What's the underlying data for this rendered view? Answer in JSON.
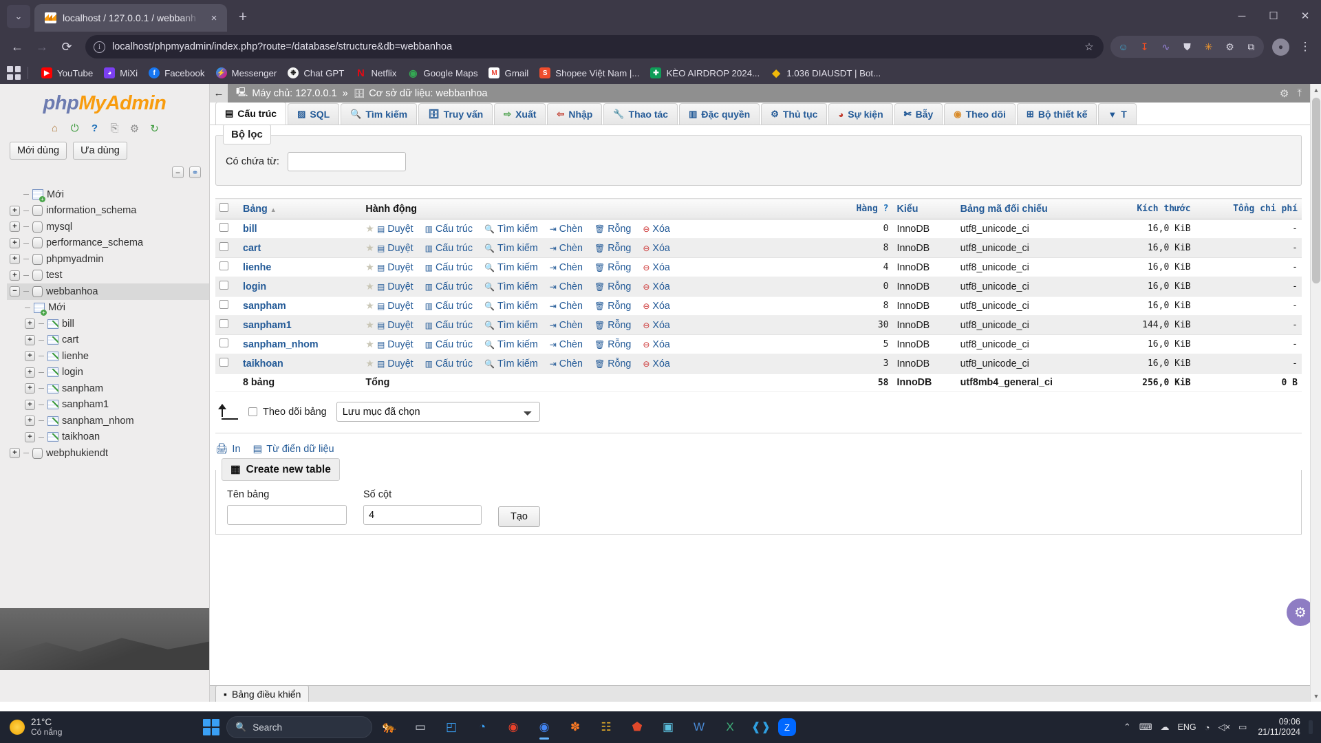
{
  "browser": {
    "tab": {
      "title": "localhost / 127.0.0.1 / webbanh",
      "favicon": "phpmyadmin-icon",
      "close": "×"
    },
    "new_tab_label": "+",
    "tab_list_label": "⌄",
    "window_controls": {
      "minimize": "─",
      "maximize": "☐",
      "close": "✕"
    },
    "nav": {
      "back": "←",
      "forward": "→",
      "reload": "⟳"
    },
    "omnibox": {
      "info_icon": "i",
      "url": "localhost/phpmyadmin/index.php?route=/database/structure&db=webbanhoa",
      "bookmark_star": "☆"
    },
    "extensions": [
      {
        "name": "smiley-extension-icon",
        "glyph": "☺",
        "color": "#3fa9d0"
      },
      {
        "name": "idm-extension-icon",
        "glyph": "↧",
        "color": "#f04e23"
      },
      {
        "name": "wave-extension-icon",
        "glyph": "∿",
        "color": "#7a60c8"
      },
      {
        "name": "shield-extension-icon",
        "glyph": "⛊",
        "color": "#cdd0d8"
      },
      {
        "name": "star-extension-icon",
        "glyph": "✳",
        "color": "#f0972e"
      },
      {
        "name": "gear-extension-icon",
        "glyph": "⚙",
        "color": "#cdd0d8"
      },
      {
        "name": "puzzle-extension-icon",
        "glyph": "⧉",
        "color": "#cdd0d8"
      }
    ],
    "profile_initial": "●",
    "menu_glyph": "⋮",
    "bookmarks": [
      {
        "label": "YouTube",
        "icon": "youtube-icon",
        "glyph": "▶",
        "color": "#ff0000"
      },
      {
        "label": "MiXi",
        "icon": "mixi-icon",
        "glyph": "◕",
        "color": "#7b3ff2"
      },
      {
        "label": "Facebook",
        "icon": "facebook-icon",
        "glyph": "f",
        "color": "#1877f2"
      },
      {
        "label": "Messenger",
        "icon": "messenger-icon",
        "glyph": "⚡",
        "color": "#a033ff"
      },
      {
        "label": "Chat GPT",
        "icon": "chatgpt-icon",
        "glyph": "✿",
        "color": "#f4f4f4"
      },
      {
        "label": "Netflix",
        "icon": "netflix-icon",
        "glyph": "N",
        "color": "#e50914"
      },
      {
        "label": "Google Maps",
        "icon": "googlemaps-icon",
        "glyph": "◉",
        "color": "#34a853"
      },
      {
        "label": "Gmail",
        "icon": "gmail-icon",
        "glyph": "M",
        "color": "#ea4335"
      },
      {
        "label": "Shopee Việt Nam |...",
        "icon": "shopee-icon",
        "glyph": "S",
        "color": "#ee4d2d"
      },
      {
        "label": "KÈO AIRDROP 2024...",
        "icon": "sheets-icon",
        "glyph": "✚",
        "color": "#0f9d58"
      },
      {
        "label": "1.036 DIAUSDT | Bot...",
        "icon": "binance-icon",
        "glyph": "◆",
        "color": "#f0b90b"
      }
    ],
    "apps_button": "apps-grid-icon"
  },
  "pma": {
    "logo": {
      "part1": "php",
      "part2": "MyAdmin"
    },
    "header_icons": [
      {
        "name": "home-icon",
        "glyph": "⌂"
      },
      {
        "name": "logout-icon",
        "glyph": "⏻"
      },
      {
        "name": "help-icon",
        "glyph": "?"
      },
      {
        "name": "docs-icon",
        "glyph": "⎘"
      },
      {
        "name": "settings-icon",
        "glyph": "⚙"
      },
      {
        "name": "reload-icon",
        "glyph": "↻"
      }
    ],
    "quick_buttons": [
      {
        "label": "Mới dùng",
        "name": "recent-button"
      },
      {
        "label": "Ưa dùng",
        "name": "favourites-button"
      }
    ],
    "collapse_icons": [
      {
        "name": "collapse-all-icon",
        "glyph": "−"
      },
      {
        "name": "unlink-icon",
        "glyph": "⚭"
      }
    ],
    "tree": [
      {
        "label": "Mới",
        "type": "new",
        "expander": "none",
        "indent": 0,
        "selected": false
      },
      {
        "label": "information_schema",
        "type": "db",
        "expander": "+",
        "indent": 0,
        "selected": false
      },
      {
        "label": "mysql",
        "type": "db",
        "expander": "+",
        "indent": 0,
        "selected": false
      },
      {
        "label": "performance_schema",
        "type": "db",
        "expander": "+",
        "indent": 0,
        "selected": false
      },
      {
        "label": "phpmyadmin",
        "type": "db",
        "expander": "+",
        "indent": 0,
        "selected": false
      },
      {
        "label": "test",
        "type": "db",
        "expander": "+",
        "indent": 0,
        "selected": false
      },
      {
        "label": "webbanhoa",
        "type": "db",
        "expander": "−",
        "indent": 0,
        "selected": true
      },
      {
        "label": "Mới",
        "type": "new",
        "expander": "none",
        "indent": 1,
        "selected": false
      },
      {
        "label": "bill",
        "type": "table",
        "expander": "+",
        "indent": 1,
        "selected": false
      },
      {
        "label": "cart",
        "type": "table",
        "expander": "+",
        "indent": 1,
        "selected": false
      },
      {
        "label": "lienhe",
        "type": "table",
        "expander": "+",
        "indent": 1,
        "selected": false
      },
      {
        "label": "login",
        "type": "table",
        "expander": "+",
        "indent": 1,
        "selected": false
      },
      {
        "label": "sanpham",
        "type": "table",
        "expander": "+",
        "indent": 1,
        "selected": false
      },
      {
        "label": "sanpham1",
        "type": "table",
        "expander": "+",
        "indent": 1,
        "selected": false
      },
      {
        "label": "sanpham_nhom",
        "type": "table",
        "expander": "+",
        "indent": 1,
        "selected": false
      },
      {
        "label": "taikhoan",
        "type": "table",
        "expander": "+",
        "indent": 1,
        "selected": false
      },
      {
        "label": "webphukiendt",
        "type": "db",
        "expander": "+",
        "indent": 0,
        "selected": false
      }
    ],
    "breadcrumb": {
      "back_glyph": "←",
      "server_icon": "server-icon",
      "server_label": "Máy chủ: 127.0.0.1",
      "separator": "»",
      "db_icon": "database-icon",
      "db_label": "Cơ sở dữ liệu: webbanhoa",
      "settings_glyph": "⚙",
      "collapse_glyph": "⤒"
    },
    "tabs": [
      {
        "label": "Cấu trúc",
        "icon": "structure-icon",
        "glyph": "▤",
        "active": true
      },
      {
        "label": "SQL",
        "icon": "sql-icon",
        "glyph": "⌸",
        "active": false
      },
      {
        "label": "Tìm kiếm",
        "icon": "search-icon",
        "glyph": "⌕",
        "active": false
      },
      {
        "label": "Truy vấn",
        "icon": "query-icon",
        "glyph": "⛃",
        "active": false
      },
      {
        "label": "Xuất",
        "icon": "export-icon",
        "glyph": "⇨",
        "active": false
      },
      {
        "label": "Nhập",
        "icon": "import-icon",
        "glyph": "⇦",
        "active": false
      },
      {
        "label": "Thao tác",
        "icon": "operations-icon",
        "glyph": "⚒",
        "active": false
      },
      {
        "label": "Đặc quyền",
        "icon": "privileges-icon",
        "glyph": "▥",
        "active": false
      },
      {
        "label": "Thủ tục",
        "icon": "routines-icon",
        "glyph": "⚙",
        "active": false
      },
      {
        "label": "Sự kiện",
        "icon": "events-icon",
        "glyph": "◴",
        "active": false
      },
      {
        "label": "Bẫy",
        "icon": "triggers-icon",
        "glyph": "✂",
        "active": false
      },
      {
        "label": "Theo dõi",
        "icon": "tracking-icon",
        "glyph": "◉",
        "active": false
      },
      {
        "label": "Bộ thiết kế",
        "icon": "designer-icon",
        "glyph": "⊞",
        "active": false
      },
      {
        "label": "T",
        "icon": "more-tabs-icon",
        "glyph": "▼",
        "active": false
      }
    ],
    "filter": {
      "legend": "Bộ lọc",
      "label": "Có chứa từ:",
      "value": "",
      "placeholder": ""
    },
    "table": {
      "columns": [
        {
          "label": "Bảng",
          "sort": "▲",
          "name": "col-table"
        },
        {
          "label": "Hành động",
          "name": "col-action"
        },
        {
          "label": "Hàng",
          "help": "?",
          "name": "col-rows"
        },
        {
          "label": "Kiểu",
          "name": "col-type"
        },
        {
          "label": "Bảng mã đối chiếu",
          "name": "col-collation"
        },
        {
          "label": "Kích thước",
          "name": "col-size"
        },
        {
          "label": "Tổng chi phí",
          "name": "col-overhead"
        }
      ],
      "actions": [
        {
          "label": "Duyệt",
          "icon": "browse-icon",
          "glyph": "▤"
        },
        {
          "label": "Cấu trúc",
          "icon": "structure-icon",
          "glyph": "▥"
        },
        {
          "label": "Tìm kiếm",
          "icon": "search-icon",
          "glyph": "⌕"
        },
        {
          "label": "Chèn",
          "icon": "insert-icon",
          "glyph": "⤓"
        },
        {
          "label": "Rỗng",
          "icon": "empty-icon",
          "glyph": "⌸"
        },
        {
          "label": "Xóa",
          "icon": "drop-icon",
          "glyph": "⊖"
        }
      ],
      "rows": [
        {
          "name": "bill",
          "rows": "0",
          "type": "InnoDB",
          "collation": "utf8_unicode_ci",
          "size": "16,0 KiB",
          "overhead": "-"
        },
        {
          "name": "cart",
          "rows": "8",
          "type": "InnoDB",
          "collation": "utf8_unicode_ci",
          "size": "16,0 KiB",
          "overhead": "-"
        },
        {
          "name": "lienhe",
          "rows": "4",
          "type": "InnoDB",
          "collation": "utf8_unicode_ci",
          "size": "16,0 KiB",
          "overhead": "-"
        },
        {
          "name": "login",
          "rows": "0",
          "type": "InnoDB",
          "collation": "utf8_unicode_ci",
          "size": "16,0 KiB",
          "overhead": "-"
        },
        {
          "name": "sanpham",
          "rows": "8",
          "type": "InnoDB",
          "collation": "utf8_unicode_ci",
          "size": "16,0 KiB",
          "overhead": "-"
        },
        {
          "name": "sanpham1",
          "rows": "30",
          "type": "InnoDB",
          "collation": "utf8_unicode_ci",
          "size": "144,0 KiB",
          "overhead": "-"
        },
        {
          "name": "sanpham_nhom",
          "rows": "5",
          "type": "InnoDB",
          "collation": "utf8_unicode_ci",
          "size": "16,0 KiB",
          "overhead": "-"
        },
        {
          "name": "taikhoan",
          "rows": "3",
          "type": "InnoDB",
          "collation": "utf8_unicode_ci",
          "size": "16,0 KiB",
          "overhead": "-"
        }
      ],
      "summary": {
        "count_label": "8 bảng",
        "total_label": "Tổng",
        "rows": "58",
        "type": "InnoDB",
        "collation": "utf8mb4_general_ci",
        "size": "256,0 KiB",
        "overhead": "0 B"
      }
    },
    "below_table": {
      "check_all_icon": "select-all-arrow-icon",
      "track_label": "Theo dõi bảng",
      "with_selected": "Lưu mục đã chọn"
    },
    "print_row": [
      {
        "label": "In",
        "icon": "print-icon",
        "glyph": "⎙"
      },
      {
        "label": "Từ điển dữ liệu",
        "icon": "data-dictionary-icon",
        "glyph": "▤"
      }
    ],
    "create_table": {
      "legend": "Create new table",
      "legend_icon": "new-table-icon",
      "name_label": "Tên bảng",
      "name_value": "",
      "cols_label": "Số cột",
      "cols_value": "4",
      "submit_label": "Tạo"
    },
    "console": {
      "label": "Bảng điều khiển",
      "icon": "console-icon",
      "glyph": "■"
    },
    "float_gear": {
      "name": "settings-fab-icon",
      "glyph": "⚙",
      "color": "#8e7cc3"
    },
    "scrollbar": {
      "up": "▲",
      "down": "▼"
    }
  },
  "taskbar": {
    "weather": {
      "temp": "21°C",
      "desc": "Có nắng",
      "icon": "sun-icon"
    },
    "start": {
      "name": "start-button",
      "label": "Start"
    },
    "search": {
      "placeholder": "Search",
      "icon": "search-icon"
    },
    "apps": [
      {
        "name": "taskview-icon",
        "glyph": "▭",
        "color": "#cfd3da",
        "active": false
      },
      {
        "name": "widgets-icon",
        "glyph": "◰",
        "color": "#3aa0f5",
        "active": false
      },
      {
        "name": "edge-icon",
        "glyph": "◔",
        "color": "#3aa0f5",
        "active": false
      },
      {
        "name": "opera-gx-icon",
        "glyph": "◉",
        "color": "#e8412a",
        "active": false
      },
      {
        "name": "chrome-icon",
        "glyph": "◉",
        "color": "#4285f4",
        "active": true
      },
      {
        "name": "xampp-icon",
        "glyph": "✽",
        "color": "#fb7a24",
        "active": false
      },
      {
        "name": "file-explorer-icon",
        "glyph": "☷",
        "color": "#f0b429",
        "active": false
      },
      {
        "name": "brave-icon",
        "glyph": "⬟",
        "color": "#e0492b",
        "active": false
      },
      {
        "name": "store-icon",
        "glyph": "▣",
        "color": "#5bc0de",
        "active": false
      },
      {
        "name": "word-icon",
        "glyph": "W",
        "color": "#2b579a",
        "active": false
      },
      {
        "name": "excel-icon",
        "glyph": "X",
        "color": "#1e7145",
        "active": false
      },
      {
        "name": "vscode-icon",
        "glyph": "❰❱",
        "color": "#2f9fe0",
        "active": false
      },
      {
        "name": "zalo-icon",
        "glyph": "Z",
        "color": "#0068ff",
        "active": false
      }
    ],
    "tray": [
      {
        "name": "tray-expand-icon",
        "glyph": "⌃"
      },
      {
        "name": "keyboard-icon",
        "glyph": "⌨"
      },
      {
        "name": "onedrive-icon",
        "glyph": "☁"
      },
      {
        "name": "language-indicator",
        "glyph": "ENG"
      },
      {
        "name": "network-icon",
        "glyph": "◔"
      },
      {
        "name": "volume-icon",
        "glyph": "◁×"
      },
      {
        "name": "battery-icon",
        "glyph": "▭"
      }
    ],
    "clock": {
      "time": "09:06",
      "date": "21/11/2024"
    },
    "notification": {
      "name": "notification-bar"
    }
  }
}
